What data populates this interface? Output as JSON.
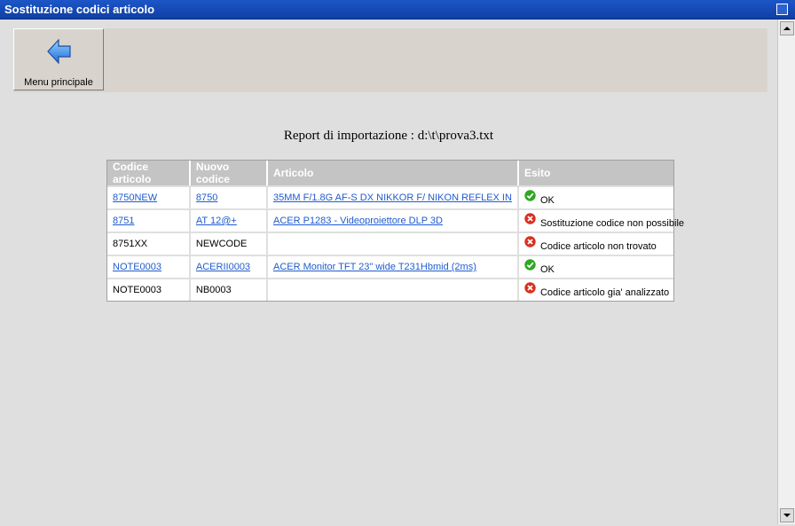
{
  "window": {
    "title": "Sostituzione codici articolo"
  },
  "toolbar": {
    "menu_label": "Menu principale"
  },
  "report": {
    "title": "Report di importazione : d:\\t\\prova3.txt"
  },
  "table": {
    "headers": [
      "Codice articolo",
      "Nuovo codice",
      "Articolo",
      "Esito"
    ],
    "rows": [
      {
        "codice": "8750NEW",
        "nuovo": "8750",
        "articolo": "35MM F/1.8G AF-S DX NIKKOR F/ NIKON REFLEX IN",
        "esito": "OK",
        "status": "ok"
      },
      {
        "codice": "8751",
        "nuovo": "AT 12@+",
        "articolo": "ACER P1283 - Videoproiettore DLP 3D",
        "esito": "Sostituzione codice non possibile",
        "status": "error"
      },
      {
        "codice": "8751XX",
        "nuovo": "NEWCODE",
        "articolo": "",
        "esito": "Codice articolo non trovato",
        "status": "error"
      },
      {
        "codice": "NOTE0003",
        "nuovo": "ACERII0003",
        "articolo": "ACER Monitor TFT 23\" wide T231Hbmid (2ms)",
        "esito": "OK",
        "status": "ok"
      },
      {
        "codice": "NOTE0003",
        "nuovo": "NB0003",
        "articolo": "",
        "esito": "Codice articolo gia' analizzato",
        "status": "error"
      }
    ]
  },
  "colors": {
    "link": "#1f5ccf",
    "ok": "#2ea81f",
    "error": "#d8301f"
  }
}
